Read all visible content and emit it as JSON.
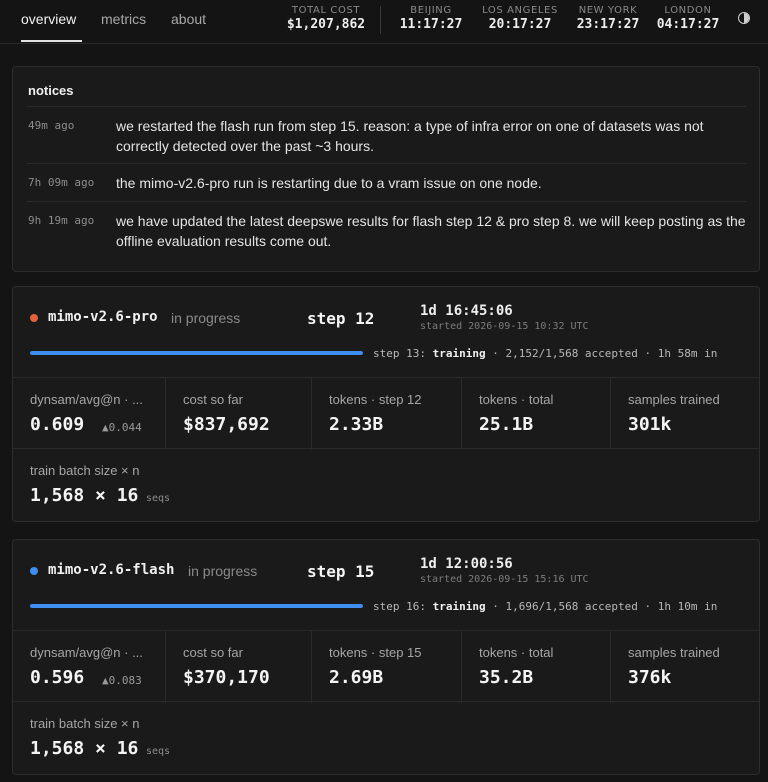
{
  "nav": {
    "tabs": [
      {
        "label": "overview",
        "active": true
      },
      {
        "label": "metrics",
        "active": false
      },
      {
        "label": "about",
        "active": false
      }
    ]
  },
  "header_stats": {
    "total_cost": {
      "label": "TOTAL COST",
      "value": "$1,207,862"
    },
    "clocks": [
      {
        "label": "BEIJING",
        "value": "11:17:27"
      },
      {
        "label": "LOS ANGELES",
        "value": "20:17:27"
      },
      {
        "label": "NEW YORK",
        "value": "23:17:27"
      },
      {
        "label": "LONDON",
        "value": "04:17:27"
      }
    ],
    "theme_toggle_icon": "half-circle-icon"
  },
  "notices": {
    "title": "notices",
    "items": [
      {
        "time": "49m ago",
        "text": "we restarted the flash run from step 15. reason: a type of infra error on one of datasets was not correctly detected over the past ~3 hours."
      },
      {
        "time": "7h 09m ago",
        "text": "the mimo-v2.6-pro run is restarting due to a vram issue on one node."
      },
      {
        "time": "9h 19m ago",
        "text": "we have updated the latest deepswe results for flash step 12 & pro step 8. we will keep posting as the offline evaluation results come out."
      }
    ]
  },
  "runs": [
    {
      "name": "mimo-v2.6-pro",
      "status": "in progress",
      "dot_color": "#e5623a",
      "step": "step 12",
      "duration": "1d 16:45:06",
      "started": "started 2026-09-15 10:32 UTC",
      "progress_fraction": 1.0,
      "progress_prefix": "step 13:",
      "progress_phase": "training",
      "progress_suffix": "· 2,152/1,568 accepted · 1h 58m in",
      "metrics": [
        {
          "label": "dynsam/avg@n · ...",
          "value": "0.609",
          "delta": "▲0.044"
        },
        {
          "label": "cost so far",
          "value": "$837,692"
        },
        {
          "label": "tokens · step 12",
          "value": "2.33B"
        },
        {
          "label": "tokens · total",
          "value": "25.1B"
        },
        {
          "label": "samples trained",
          "value": "301k"
        }
      ],
      "batch": {
        "label": "train batch size × n",
        "value": "1,568 × 16",
        "unit": "seqs"
      }
    },
    {
      "name": "mimo-v2.6-flash",
      "status": "in progress",
      "dot_color": "#3d8ef0",
      "step": "step 15",
      "duration": "1d 12:00:56",
      "started": "started 2026-09-15 15:16 UTC",
      "progress_fraction": 1.0,
      "progress_prefix": "step 16:",
      "progress_phase": "training",
      "progress_suffix": "· 1,696/1,568 accepted · 1h 10m in",
      "metrics": [
        {
          "label": "dynsam/avg@n · ...",
          "value": "0.596",
          "delta": "▲0.083"
        },
        {
          "label": "cost so far",
          "value": "$370,170"
        },
        {
          "label": "tokens · step 15",
          "value": "2.69B"
        },
        {
          "label": "tokens · total",
          "value": "35.2B"
        },
        {
          "label": "samples trained",
          "value": "376k"
        }
      ],
      "batch": {
        "label": "train batch size × n",
        "value": "1,568 × 16",
        "unit": "seqs"
      }
    }
  ]
}
